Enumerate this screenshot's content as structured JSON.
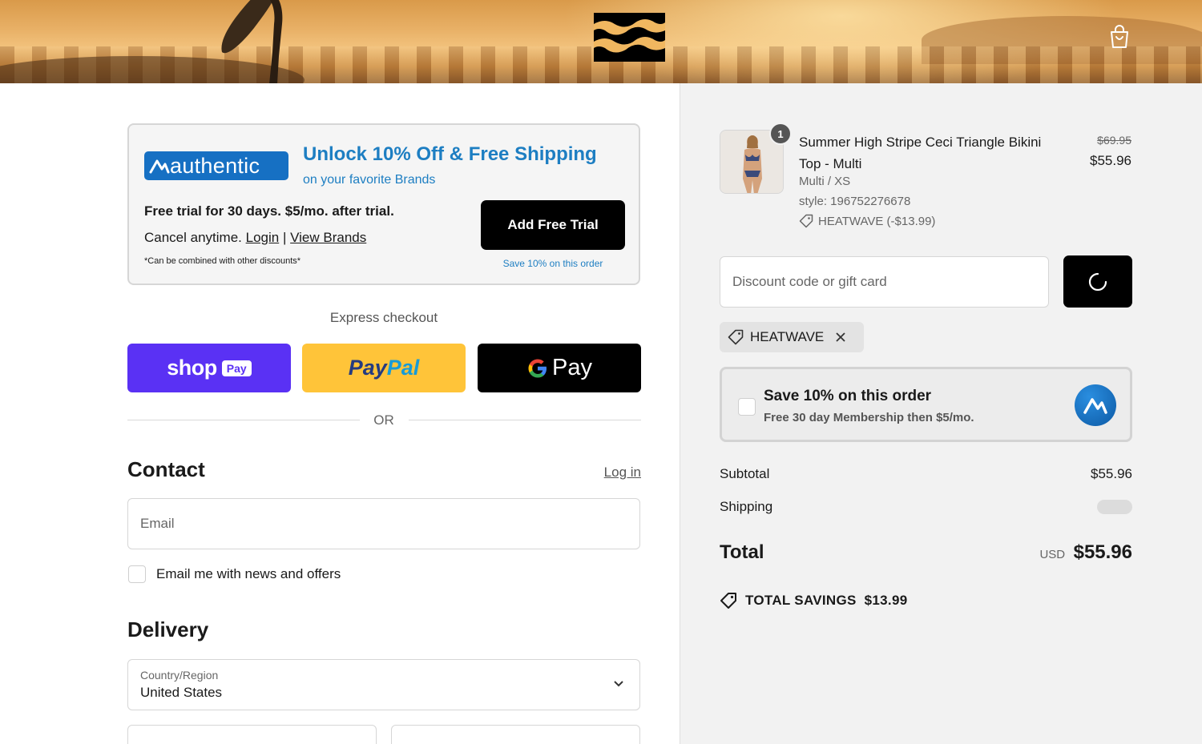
{
  "brand": {
    "logo_name": "billabong-logo"
  },
  "authentic": {
    "logo_text": "authentic",
    "title": "Unlock 10% Off & Free Shipping",
    "subtitle": "on your favorite Brands",
    "free_trial": "Free trial for 30 days. $5/mo. after trial.",
    "cancel_text": "Cancel anytime.",
    "login_link": "Login",
    "separator": "|",
    "view_brands_link": "View Brands",
    "note": "*Can be combined with other discounts*",
    "add_button": "Add Free Trial",
    "save_note": "Save 10% on this order",
    "accent_color": "#1d7ec2"
  },
  "express": {
    "label": "Express checkout",
    "shop_pay": {
      "text": "shop",
      "pill": "Pay"
    },
    "paypal": {
      "part1": "Pay",
      "part2": "Pal"
    },
    "gpay": {
      "text": "Pay"
    },
    "or_text": "OR"
  },
  "contact": {
    "heading": "Contact",
    "login_link": "Log in",
    "email_placeholder": "Email",
    "newsletter_label": "Email me with news and offers"
  },
  "delivery": {
    "heading": "Delivery",
    "country_label": "Country/Region",
    "country_value": "United States"
  },
  "order": {
    "quantity": "1",
    "product_name": "Summer High Stripe Ceci Triangle Bikini Top - Multi",
    "variant": "Multi / XS",
    "style": "style: 196752276678",
    "discount_line": "HEATWAVE (-$13.99)",
    "old_price": "$69.95",
    "new_price": "$55.96"
  },
  "discount": {
    "placeholder": "Discount code or gift card",
    "applied_code": "HEATWAVE"
  },
  "membership": {
    "title": "Save 10% on this order",
    "subtitle": "Free 30 day Membership then $5/mo."
  },
  "summary": {
    "subtotal_label": "Subtotal",
    "subtotal_value": "$55.96",
    "shipping_label": "Shipping",
    "total_label": "Total",
    "currency": "USD",
    "total_value": "$55.96",
    "savings_label": "TOTAL SAVINGS",
    "savings_value": "$13.99"
  }
}
